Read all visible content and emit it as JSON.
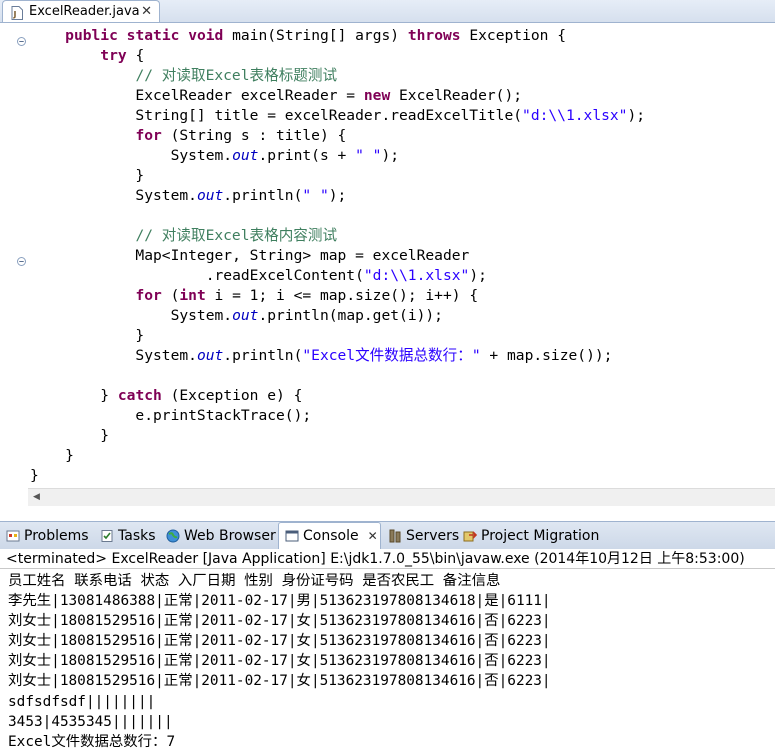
{
  "editor": {
    "tab": {
      "label": "ExcelReader.java",
      "close": "✕"
    },
    "code_lines": [
      [
        {
          "t": "    ",
          "c": ""
        },
        {
          "t": "public",
          "c": "kw"
        },
        {
          "t": " ",
          "c": ""
        },
        {
          "t": "static",
          "c": "kw"
        },
        {
          "t": " ",
          "c": ""
        },
        {
          "t": "void",
          "c": "kw"
        },
        {
          "t": " main(String[] args) ",
          "c": ""
        },
        {
          "t": "throws",
          "c": "kw"
        },
        {
          "t": " Exception {",
          "c": ""
        }
      ],
      [
        {
          "t": "        ",
          "c": ""
        },
        {
          "t": "try",
          "c": "kw"
        },
        {
          "t": " {",
          "c": ""
        }
      ],
      [
        {
          "t": "            ",
          "c": ""
        },
        {
          "t": "// 对读取Excel表格标题测试",
          "c": "cm"
        }
      ],
      [
        {
          "t": "            ExcelReader excelReader = ",
          "c": ""
        },
        {
          "t": "new",
          "c": "kw"
        },
        {
          "t": " ExcelReader();",
          "c": ""
        }
      ],
      [
        {
          "t": "            String[] title = excelReader.readExcelTitle(",
          "c": ""
        },
        {
          "t": "\"d:\\\\1.xlsx\"",
          "c": "str"
        },
        {
          "t": ");",
          "c": ""
        }
      ],
      [
        {
          "t": "            ",
          "c": ""
        },
        {
          "t": "for",
          "c": "kw"
        },
        {
          "t": " (String s : title) {",
          "c": ""
        }
      ],
      [
        {
          "t": "                System.",
          "c": ""
        },
        {
          "t": "out",
          "c": "st"
        },
        {
          "t": ".print(s + ",
          "c": ""
        },
        {
          "t": "\" \"",
          "c": "str"
        },
        {
          "t": ");",
          "c": ""
        }
      ],
      [
        {
          "t": "            }",
          "c": ""
        }
      ],
      [
        {
          "t": "            System.",
          "c": ""
        },
        {
          "t": "out",
          "c": "st"
        },
        {
          "t": ".println(",
          "c": ""
        },
        {
          "t": "\" \"",
          "c": "str"
        },
        {
          "t": ");",
          "c": ""
        }
      ],
      [
        {
          "t": "",
          "c": ""
        }
      ],
      [
        {
          "t": "            ",
          "c": ""
        },
        {
          "t": "// 对读取Excel表格内容测试",
          "c": "cm"
        }
      ],
      [
        {
          "t": "            Map<Integer, String> map = excelReader",
          "c": ""
        }
      ],
      [
        {
          "t": "                    .readExcelContent(",
          "c": ""
        },
        {
          "t": "\"d:\\\\1.xlsx\"",
          "c": "str"
        },
        {
          "t": ");",
          "c": ""
        }
      ],
      [
        {
          "t": "            ",
          "c": ""
        },
        {
          "t": "for",
          "c": "kw"
        },
        {
          "t": " (",
          "c": ""
        },
        {
          "t": "int",
          "c": "kw"
        },
        {
          "t": " i = 1; i <= map.size(); i++) {",
          "c": ""
        }
      ],
      [
        {
          "t": "                System.",
          "c": ""
        },
        {
          "t": "out",
          "c": "st"
        },
        {
          "t": ".println(map.get(i));",
          "c": ""
        }
      ],
      [
        {
          "t": "            }",
          "c": ""
        }
      ],
      [
        {
          "t": "            System.",
          "c": ""
        },
        {
          "t": "out",
          "c": "st"
        },
        {
          "t": ".println(",
          "c": ""
        },
        {
          "t": "\"Excel文件数据总数行：\"",
          "c": "str"
        },
        {
          "t": " + map.size());",
          "c": ""
        }
      ],
      [
        {
          "t": "",
          "c": ""
        }
      ],
      [
        {
          "t": "        } ",
          "c": ""
        },
        {
          "t": "catch",
          "c": "kw"
        },
        {
          "t": " (Exception e) {",
          "c": ""
        }
      ],
      [
        {
          "t": "            e.printStackTrace();",
          "c": ""
        }
      ],
      [
        {
          "t": "        }",
          "c": ""
        }
      ],
      [
        {
          "t": "    }",
          "c": ""
        }
      ],
      [
        {
          "t": "}",
          "c": ""
        }
      ]
    ],
    "fold_rows": [
      0,
      11
    ]
  },
  "views": {
    "tabs": [
      {
        "label": "Problems",
        "icon": "problems-icon",
        "active": false
      },
      {
        "label": "Tasks",
        "icon": "tasks-icon",
        "active": false
      },
      {
        "label": "Web Browser",
        "icon": "globe-icon",
        "active": false
      },
      {
        "label": "Console",
        "icon": "console-icon",
        "active": true,
        "close": "✕"
      },
      {
        "label": "Servers",
        "icon": "servers-icon",
        "active": false
      },
      {
        "label": "Project Migration",
        "icon": "migration-icon",
        "active": false
      }
    ]
  },
  "console": {
    "header": "<terminated> ExcelReader [Java Application] E:\\jdk1.7.0_55\\bin\\javaw.exe (2014年10月12日 上午8:53:00)",
    "lines": [
      "员工姓名 联系电话 状态 入厂日期 性别 身份证号码 是否农民工 备注信息",
      "李先生|13081486388|正常|2011-02-17|男|513623197808134618|是|6111|",
      "刘女士|18081529516|正常|2011-02-17|女|513623197808134616|否|6223|",
      "刘女士|18081529516|正常|2011-02-17|女|513623197808134616|否|6223|",
      "刘女士|18081529516|正常|2011-02-17|女|513623197808134616|否|6223|",
      "刘女士|18081529516|正常|2011-02-17|女|513623197808134616|否|6223|",
      "sdfsdfsdf||||||||",
      "3453|4535345|||||||",
      "Excel文件数据总数行：7"
    ]
  }
}
